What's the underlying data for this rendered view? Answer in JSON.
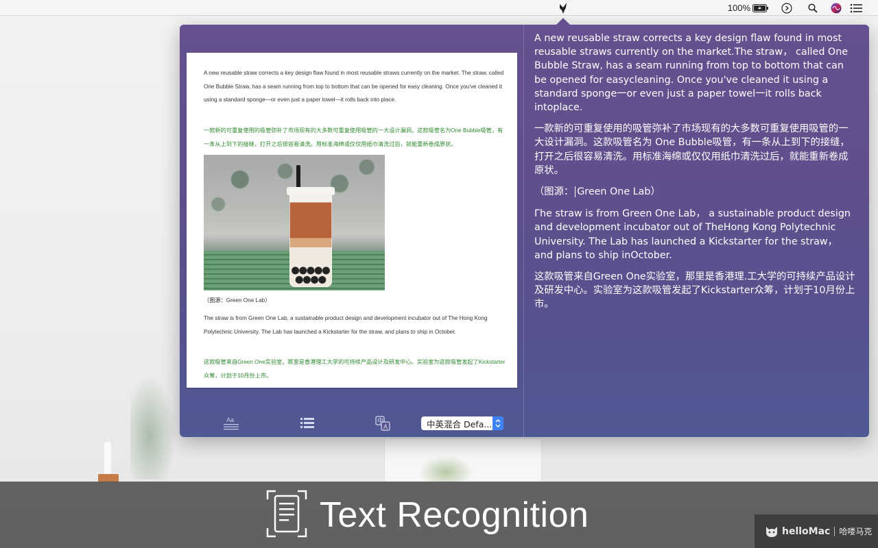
{
  "menubar": {
    "battery_percent": "100%",
    "icons": [
      "app-icon",
      "battery-icon",
      "play-circle-icon",
      "search-icon",
      "siri-icon",
      "list-icon"
    ]
  },
  "document": {
    "p1": "A new reusable straw corrects a key design flaw found in most reusable straws currently on the market. The straw, called One Bubble Straw, has a seam running from top to bottom that can be opened for easy cleaning. Once you've cleaned it using a standard sponge—or even just a paper towel—it rolls back into place.",
    "p2": "一款新的可重复使用的吸管弥补了市场现有的大多数可重复使用吸管的一大设计漏洞。这款吸管名为One Bubble吸管，有一条从上到下的接缝，打开之后很容易清洗。用标准海绵或仅仅用纸巾清洗过后，就能重新卷成原状。",
    "caption": "（图源：Green One Lab）",
    "p3": "The straw is from Green One Lab, a sustainable product design and development incubator out of The Hong Kong Polytechnic University. The Lab has launched a Kickstarter for the straw, and plans to ship in October.",
    "p4": "这款吸管来自Green One实验室，那里是香港理工大学的可持续产品设计及研发中心。实验室为这款吸管发起了Kickstarter众筹，计划于10月份上市。"
  },
  "toolbar": {
    "language_select_value": "中英混合  Defa..."
  },
  "result": {
    "p1": "A new reusable straw corrects a key design flaw found in most reusable straws currently on the market.The straw， called One Bubble Straw, has a seam running from top to bottom that can be opened for easycleaning. Once you've cleaned it using a standard sponge一or even just a paper towel一it rolls back intoplace.",
    "p2": "一款新的可重复使用的吸管弥补了市场现有的大多数可重复使用吸管的一大设计漏洞。这款吸管名为 One Bubble吸管，有一条从上到下的接缝，打开之后很容易清洗。用标准海绵或仅仅用纸巾清洗过后，就能重新卷成原状。",
    "caption_prefix": "（图源：",
    "caption_rest": "Green One Lab）",
    "p3": "Γhe straw is from Green One Lab， a sustainable product design and development incubator out of TheHong Kong Polytechnic University. The Lab has launched a Kickstarter for the straw， and plans to ship inOctober.",
    "p4": "这款吸管来自Green One实验室，那里是香港理.工大学的可持续产品设计及研发中心。实验室为这款吸管发起了Kickstarter众筹，计划于10月份上市。"
  },
  "banner": {
    "title": "Text Recognition"
  },
  "watermark": {
    "brand": "helloMac",
    "cn": "哈喽马克"
  },
  "colors": {
    "popover_top": "#66508f",
    "popover_bottom": "#4f5993",
    "chinese_text": "#2f8a2f",
    "select_accent": "#3b82f6"
  }
}
